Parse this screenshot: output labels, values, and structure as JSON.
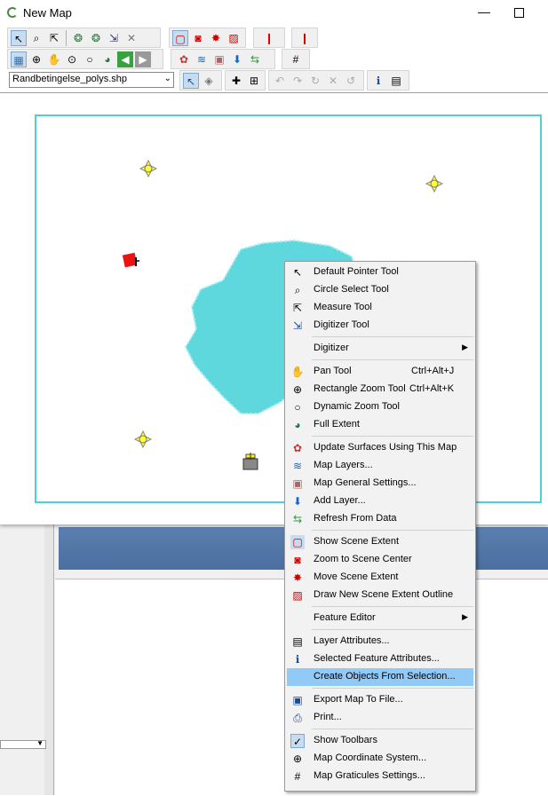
{
  "window": {
    "title": "New Map",
    "minimize_glyph": "—"
  },
  "toolbar": {
    "layer_combo_value": "Randbetingelse_polys.shp",
    "combo_arrow": "⌄"
  },
  "context_menu": {
    "items": [
      {
        "label": "Default Pointer Tool",
        "icon": "pointer-icon"
      },
      {
        "label": "Circle Select Tool",
        "icon": "circle-select-icon"
      },
      {
        "label": "Measure Tool",
        "icon": "measure-icon"
      },
      {
        "label": "Digitizer Tool",
        "icon": "digitizer-icon"
      },
      {
        "label": "Digitizer",
        "submenu": true
      },
      {
        "label": "Pan Tool",
        "shortcut": "Ctrl+Alt+J",
        "icon": "hand-icon"
      },
      {
        "label": "Rectangle Zoom Tool",
        "shortcut": "Ctrl+Alt+K",
        "icon": "zoom-rect-icon"
      },
      {
        "label": "Dynamic Zoom Tool",
        "icon": "zoom-icon"
      },
      {
        "label": "Full Extent",
        "icon": "globe-icon"
      },
      {
        "label": "Update Surfaces Using This Map",
        "icon": "surfaces-icon"
      },
      {
        "label": "Map Layers...",
        "icon": "layers-icon"
      },
      {
        "label": "Map General Settings...",
        "icon": "settings-icon"
      },
      {
        "label": "Add Layer...",
        "icon": "add-layer-icon"
      },
      {
        "label": "Refresh From Data",
        "icon": "refresh-icon"
      },
      {
        "label": "Show Scene Extent",
        "icon": "scene-extent-icon"
      },
      {
        "label": "Zoom to Scene Center",
        "icon": "scene-center-icon"
      },
      {
        "label": "Move Scene Extent",
        "icon": "move-scene-icon"
      },
      {
        "label": "Draw New Scene Extent Outline",
        "icon": "draw-scene-icon"
      },
      {
        "label": "Feature Editor",
        "submenu": true
      },
      {
        "label": "Layer Attributes...",
        "icon": "table-icon"
      },
      {
        "label": "Selected Feature Attributes...",
        "icon": "info-icon"
      },
      {
        "label": "Create Objects From Selection...",
        "highlighted": true
      },
      {
        "label": "Export Map To File...",
        "icon": "save-icon"
      },
      {
        "label": "Print...",
        "icon": "printer-icon"
      },
      {
        "label": "Show Toolbars",
        "icon": "check-icon",
        "checked": true
      },
      {
        "label": "Map Coordinate System...",
        "icon": "crosshair-globe-icon"
      },
      {
        "label": "Map Graticules Settings...",
        "icon": "grid-icon"
      }
    ],
    "submenu_arrow": "▶"
  },
  "colors": {
    "polygon": "#5ed8dc",
    "frame": "#4fd0d6",
    "highlight": "#91c9f7",
    "point": "#ffff33"
  }
}
